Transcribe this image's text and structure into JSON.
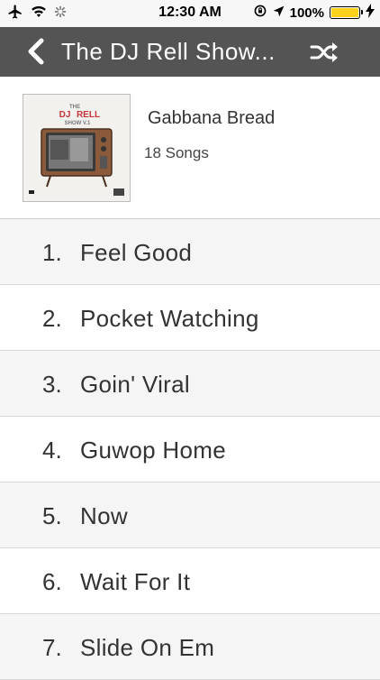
{
  "status_bar": {
    "time": "12:30 AM",
    "battery": "100%",
    "icons": [
      "airplane-icon",
      "wifi-icon",
      "activity-spinner-icon",
      "orientation-lock-icon",
      "location-arrow-icon",
      "battery-icon",
      "charging-bolt-icon"
    ],
    "battery_color": "#ffd11a"
  },
  "nav": {
    "title": "The DJ Rell Show...",
    "back_icon": "chevron-left-icon",
    "shuffle_icon": "shuffle-icon",
    "background": "#545454"
  },
  "album": {
    "name": "Gabbana Bread",
    "count": "18 Songs",
    "art_text": {
      "line1": "THE",
      "line2a": "DJ",
      "line2b": "RELL",
      "line3": "SHOW V.1"
    }
  },
  "tracks": [
    {
      "number": "1.",
      "title": "Feel Good"
    },
    {
      "number": "2.",
      "title": "Pocket Watching"
    },
    {
      "number": "3.",
      "title": "Goin' Viral"
    },
    {
      "number": "4.",
      "title": "Guwop Home"
    },
    {
      "number": "5.",
      "title": "Now"
    },
    {
      "number": "6.",
      "title": "Wait For It"
    },
    {
      "number": "7.",
      "title": "Slide On Em"
    }
  ]
}
